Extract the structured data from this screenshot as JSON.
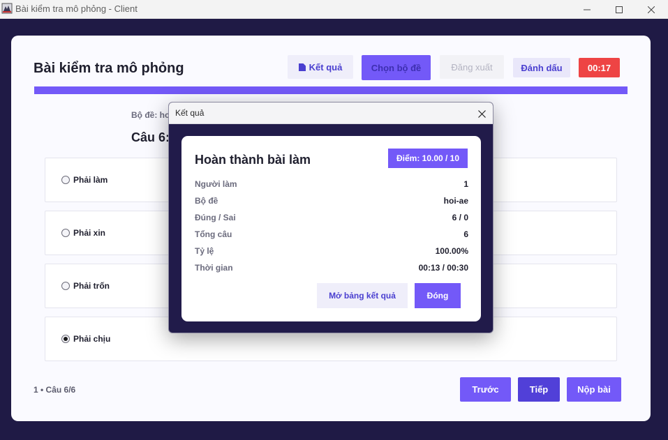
{
  "window": {
    "title": "Bài kiểm tra mô phỏng - Client",
    "icons": {
      "app": "app-logo-icon",
      "minimize": "minimize-icon",
      "maximize": "maximize-icon",
      "close": "close-icon"
    }
  },
  "header": {
    "title": "Bài kiểm tra mô phỏng",
    "buttons": {
      "ket_qua": "Kết quả",
      "chon_bo_de": "Chọn bộ đề",
      "dang_xuat": "Đăng xuất",
      "danh_dau": "Đánh dấu"
    },
    "timer": "00:17",
    "ket_qua_icon": "document-icon"
  },
  "progress": {
    "value": 1.0
  },
  "question": {
    "bo_de_label": "Bộ đề: hoi",
    "title": "Câu 6:",
    "options": [
      {
        "label": "Phải làm",
        "selected": false
      },
      {
        "label": "Phải xin",
        "selected": false
      },
      {
        "label": "Phải trốn",
        "selected": false
      },
      {
        "label": "Phải chịu",
        "selected": true
      }
    ]
  },
  "footer": {
    "status": "1 • Câu 6/6",
    "prev": "Trước",
    "next": "Tiếp",
    "submit": "Nộp bài"
  },
  "dialog": {
    "title": "Kết quả",
    "heading": "Hoàn thành bài làm",
    "score": "Điểm: 10.00 / 10",
    "rows": [
      {
        "key": "Người làm",
        "value": "1"
      },
      {
        "key": "Bộ đề",
        "value": "hoi-ae"
      },
      {
        "key": "Đúng / Sai",
        "value": "6 / 0"
      },
      {
        "key": "Tổng câu",
        "value": "6"
      },
      {
        "key": "Tỷ lệ",
        "value": "100.00%"
      },
      {
        "key": "Thời gian",
        "value": "00:13 / 00:30"
      }
    ],
    "open_board": "Mở bảng kết quả",
    "close": "Đóng"
  },
  "colors": {
    "accent": "#7359f8",
    "accent_dark": "#5140d8",
    "background": "#1f1a45",
    "timer": "#ee4444"
  }
}
